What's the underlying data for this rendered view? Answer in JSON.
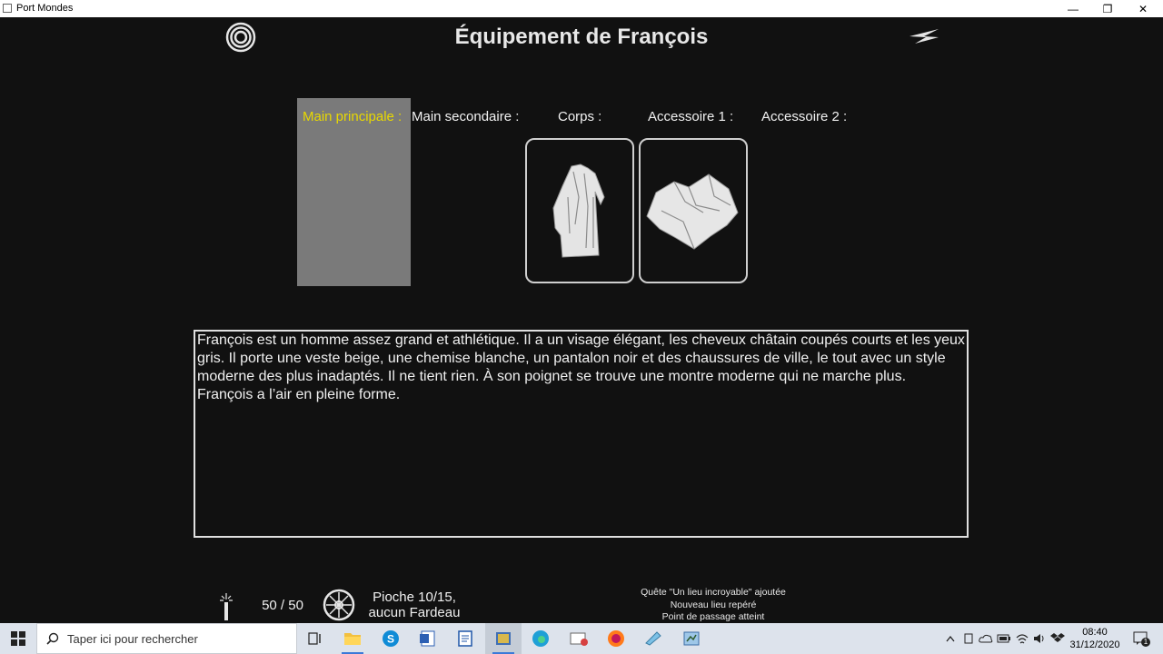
{
  "window": {
    "title": "Port Mondes",
    "minimize": "—",
    "maximize": "❐",
    "close": "✕"
  },
  "header": {
    "title": "Équipement de François"
  },
  "slots": [
    {
      "label": "Main principale :",
      "selected": true,
      "color": "#e8d800"
    },
    {
      "label": "Main secondaire :"
    },
    {
      "label": "Corps :",
      "item_icon": "robe-icon"
    },
    {
      "label": "Accessoire 1 :",
      "item_icon": "cloth-icon"
    },
    {
      "label": "Accessoire 2 :"
    }
  ],
  "description": {
    "paragraph1": "François est un homme assez grand et athlétique. Il a un visage élégant, les cheveux châtain coupés courts et les yeux gris. Il porte une veste beige, une chemise blanche, un pantalon noir et des chaussures de ville, le tout avec un style moderne des plus inadaptés. Il ne tient rien. À son poignet se trouve une montre moderne qui ne marche plus.",
    "paragraph2": "François a l’air en pleine forme."
  },
  "status": {
    "candle_value": "50 / 50",
    "draw_line1": "Pioche 10/15,",
    "draw_line2": "aucun Fardeau"
  },
  "notifications": [
    "Quête \"Un lieu incroyable\" ajoutée",
    "Nouveau lieu repéré",
    "Point de passage atteint"
  ],
  "taskbar": {
    "search_placeholder": "Taper ici pour rechercher",
    "apps": [
      "task-view-icon",
      "file-explorer-icon",
      "skype-icon",
      "word-icon",
      "document-icon",
      "port-mondes-icon",
      "edge-icon",
      "mail-icon",
      "firefox-icon",
      "app-icon",
      "app2-icon"
    ],
    "time": "08:40",
    "date": "31/12/2020",
    "notification_count": "1"
  }
}
